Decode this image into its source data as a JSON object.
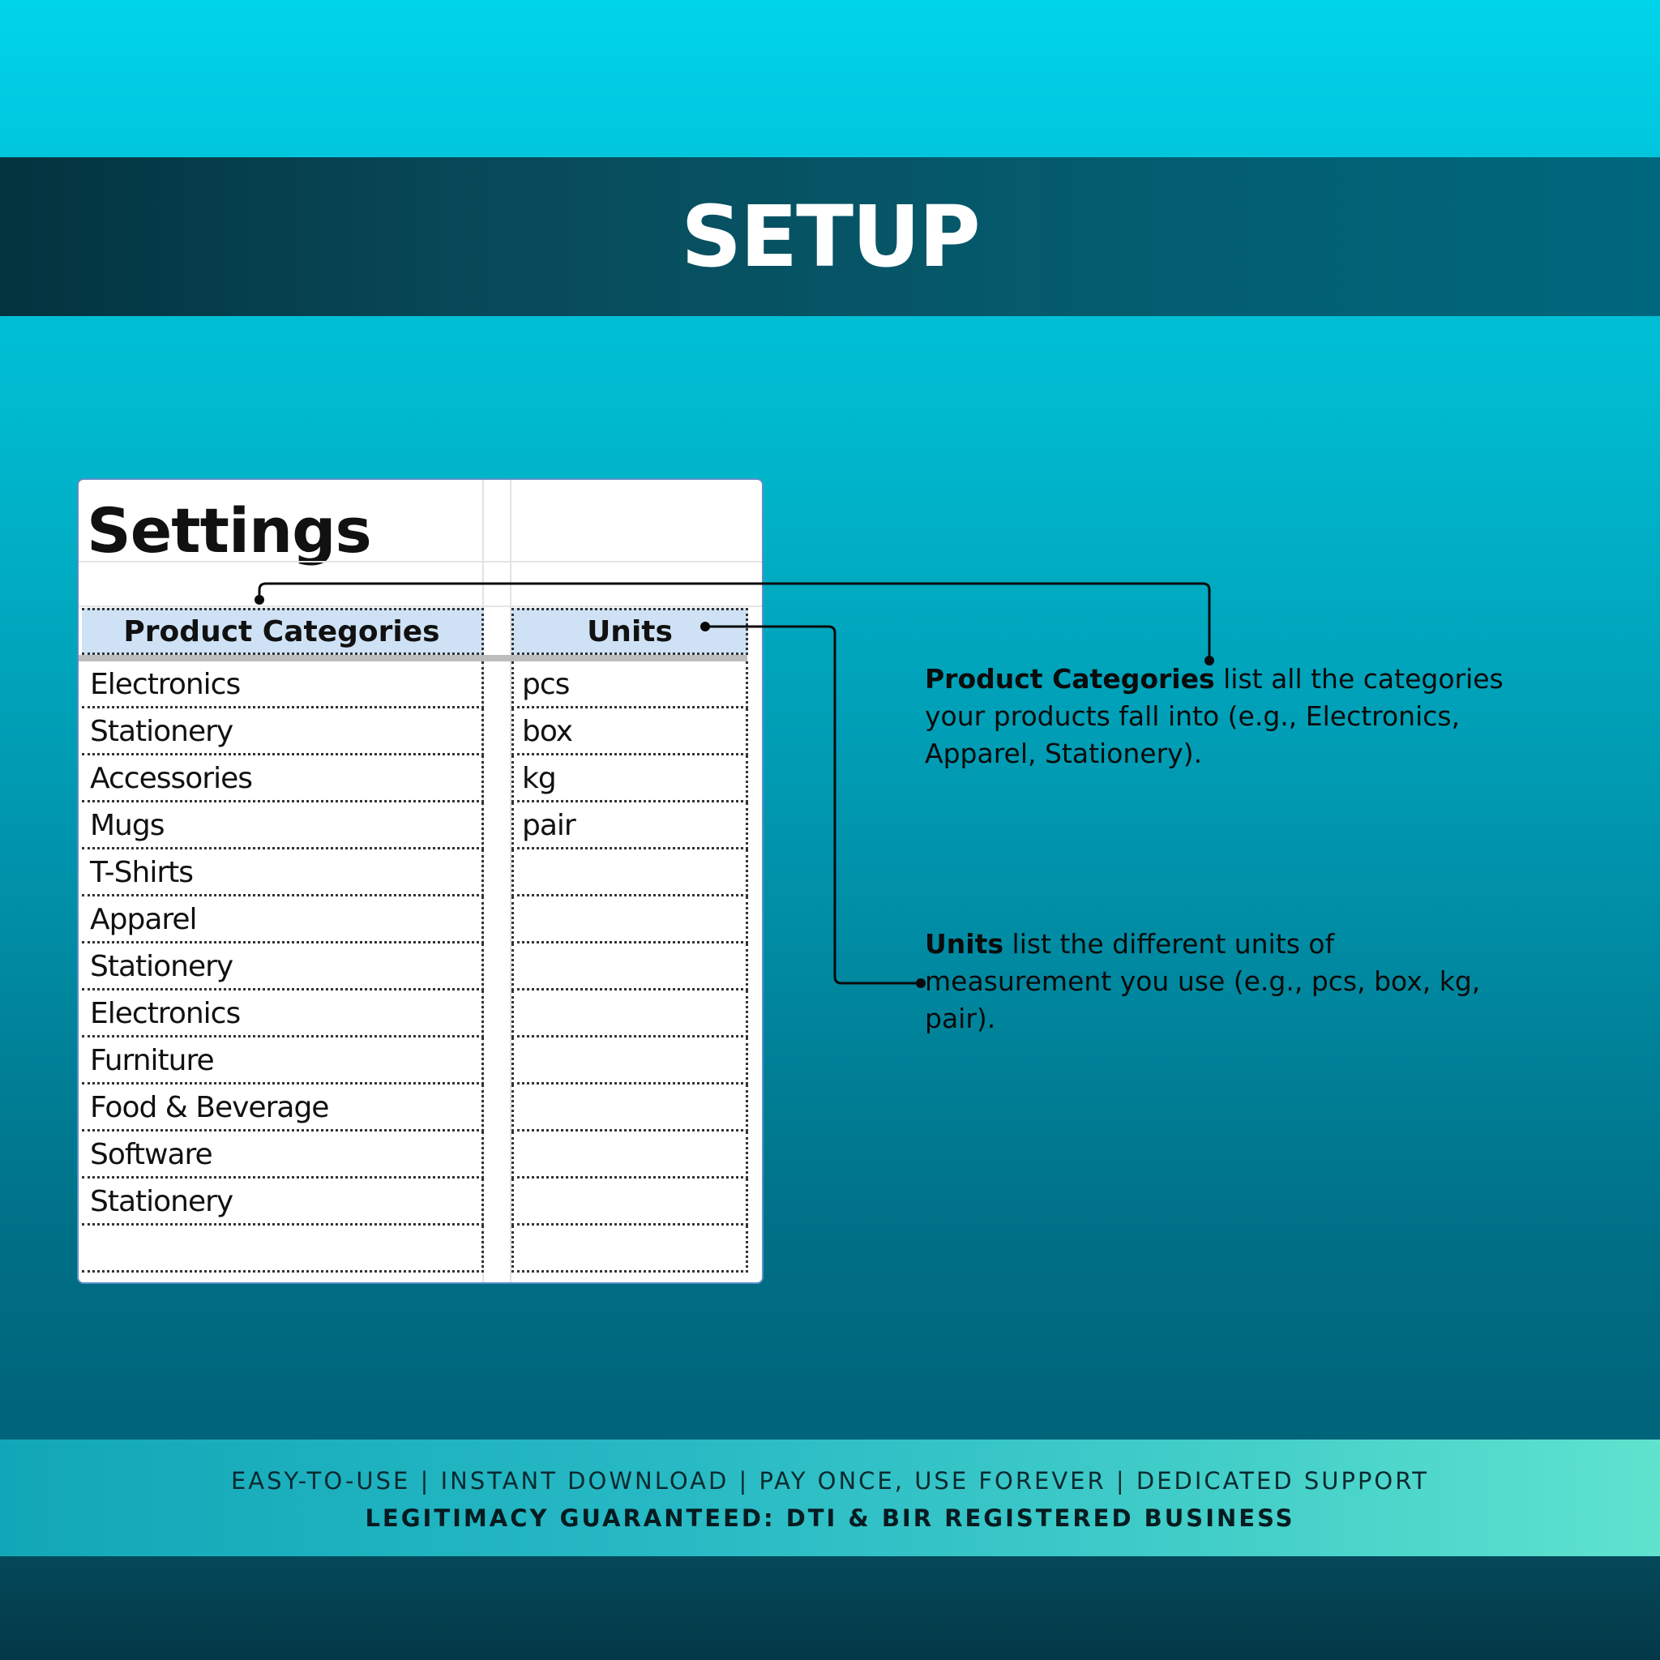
{
  "header": {
    "title": "SETUP"
  },
  "sheet": {
    "title": "Settings",
    "headers": {
      "categories": "Product Categories",
      "units": "Units"
    },
    "rows": [
      {
        "category": "Electronics",
        "unit": "pcs"
      },
      {
        "category": "Stationery",
        "unit": "box"
      },
      {
        "category": "Accessories",
        "unit": "kg"
      },
      {
        "category": "Mugs",
        "unit": "pair"
      },
      {
        "category": "T-Shirts",
        "unit": ""
      },
      {
        "category": "Apparel",
        "unit": ""
      },
      {
        "category": "Stationery",
        "unit": ""
      },
      {
        "category": "Electronics",
        "unit": ""
      },
      {
        "category": "Furniture",
        "unit": ""
      },
      {
        "category": "Food & Beverage",
        "unit": ""
      },
      {
        "category": "Software",
        "unit": ""
      },
      {
        "category": "Stationery",
        "unit": ""
      },
      {
        "category": "",
        "unit": ""
      }
    ]
  },
  "descriptions": {
    "categories": {
      "term": "Product Categories",
      "text": " list all the categories your products fall into (e.g., Electronics, Apparel, Stationery)."
    },
    "units": {
      "term": "Units",
      "text": " list the different units of measurement you use (e.g., pcs, box, kg, pair)."
    }
  },
  "footer": {
    "line1": "EASY-TO-USE | INSTANT DOWNLOAD | PAY ONCE, USE FOREVER | DEDICATED SUPPORT",
    "line2": "LEGITIMACY GUARANTEED: DTI & BIR REGISTERED BUSINESS"
  },
  "colors": {
    "header_band": "#084a5a",
    "table_header": "#cfe2f5",
    "footer_band": "#44cfc9"
  }
}
